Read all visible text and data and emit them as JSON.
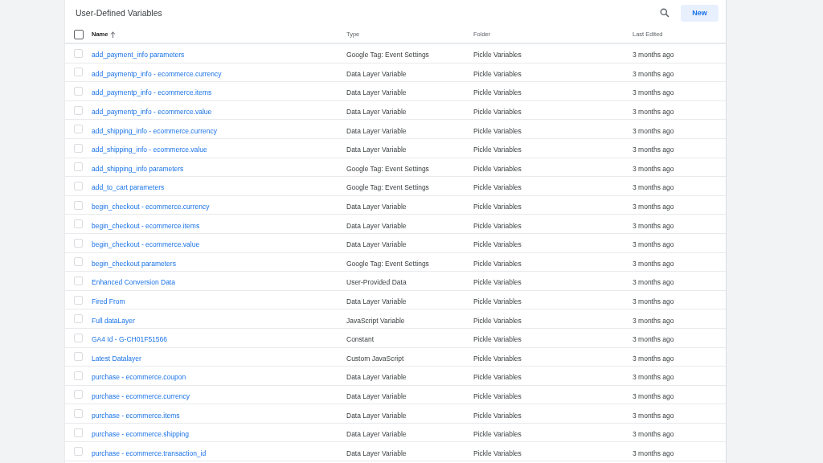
{
  "panel": {
    "title": "User-Defined Variables",
    "new_button": "New"
  },
  "table": {
    "columns": [
      {
        "label": "Name",
        "sorted": true
      },
      {
        "label": "Type",
        "sorted": false
      },
      {
        "label": "Folder",
        "sorted": false
      },
      {
        "label": "Last Edited",
        "sorted": false
      }
    ],
    "select_all": {
      "checked": false
    },
    "rows": [
      {
        "checked": false,
        "name": "add_payment_info parameters",
        "type": "Google Tag: Event Settings",
        "folder": "Pickle Variables",
        "edited": "3 months ago"
      },
      {
        "checked": false,
        "name": "add_paymentp_info - ecommerce.currency",
        "type": "Data Layer Variable",
        "folder": "Pickle Variables",
        "edited": "3 months ago"
      },
      {
        "checked": false,
        "name": "add_paymentp_info - ecommerce.items",
        "type": "Data Layer Variable",
        "folder": "Pickle Variables",
        "edited": "3 months ago"
      },
      {
        "checked": false,
        "name": "add_paymentp_info - ecommerce.value",
        "type": "Data Layer Variable",
        "folder": "Pickle Variables",
        "edited": "3 months ago"
      },
      {
        "checked": false,
        "name": "add_shipping_info - ecommerce.currency",
        "type": "Data Layer Variable",
        "folder": "Pickle Variables",
        "edited": "3 months ago"
      },
      {
        "checked": false,
        "name": "add_shipping_info - ecommerce.value",
        "type": "Data Layer Variable",
        "folder": "Pickle Variables",
        "edited": "3 months ago"
      },
      {
        "checked": false,
        "name": "add_shipping_info parameters",
        "type": "Google Tag: Event Settings",
        "folder": "Pickle Variables",
        "edited": "3 months ago"
      },
      {
        "checked": false,
        "name": "add_to_cart parameters",
        "type": "Google Tag: Event Settings",
        "folder": "Pickle Variables",
        "edited": "3 months ago"
      },
      {
        "checked": false,
        "name": "begin_checkout - ecommerce.currency",
        "type": "Data Layer Variable",
        "folder": "Pickle Variables",
        "edited": "3 months ago"
      },
      {
        "checked": false,
        "name": "begin_checkout - ecommerce.items",
        "type": "Data Layer Variable",
        "folder": "Pickle Variables",
        "edited": "3 months ago"
      },
      {
        "checked": false,
        "name": "begin_checkout - ecommerce.value",
        "type": "Data Layer Variable",
        "folder": "Pickle Variables",
        "edited": "3 months ago"
      },
      {
        "checked": false,
        "name": "begin_checkout parameters",
        "type": "Google Tag: Event Settings",
        "folder": "Pickle Variables",
        "edited": "3 months ago"
      },
      {
        "checked": false,
        "name": "Enhanced Conversion Data",
        "type": "User-Provided Data",
        "folder": "Pickle Variables",
        "edited": "3 months ago"
      },
      {
        "checked": false,
        "name": "Fired From",
        "type": "Data Layer Variable",
        "folder": "Pickle Variables",
        "edited": "3 months ago"
      },
      {
        "checked": false,
        "name": "Full dataLayer",
        "type": "JavaScript Variable",
        "folder": "Pickle Variables",
        "edited": "3 months ago"
      },
      {
        "checked": false,
        "name": "GA4 Id - G-CH01F51566",
        "type": "Constant",
        "folder": "Pickle Variables",
        "edited": "3 months ago"
      },
      {
        "checked": false,
        "name": "Latest Datalayer",
        "type": "Custom JavaScript",
        "folder": "Pickle Variables",
        "edited": "3 months ago"
      },
      {
        "checked": false,
        "name": "purchase - ecommerce.coupon",
        "type": "Data Layer Variable",
        "folder": "Pickle Variables",
        "edited": "3 months ago"
      },
      {
        "checked": false,
        "name": "purchase - ecommerce.currency",
        "type": "Data Layer Variable",
        "folder": "Pickle Variables",
        "edited": "3 months ago"
      },
      {
        "checked": false,
        "name": "purchase - ecommerce.items",
        "type": "Data Layer Variable",
        "folder": "Pickle Variables",
        "edited": "3 months ago"
      },
      {
        "checked": false,
        "name": "purchase - ecommerce.shipping",
        "type": "Data Layer Variable",
        "folder": "Pickle Variables",
        "edited": "3 months ago"
      },
      {
        "checked": false,
        "name": "purchase - ecommerce.transaction_id",
        "type": "Data Layer Variable",
        "folder": "Pickle Variables",
        "edited": "3 months ago"
      }
    ]
  }
}
